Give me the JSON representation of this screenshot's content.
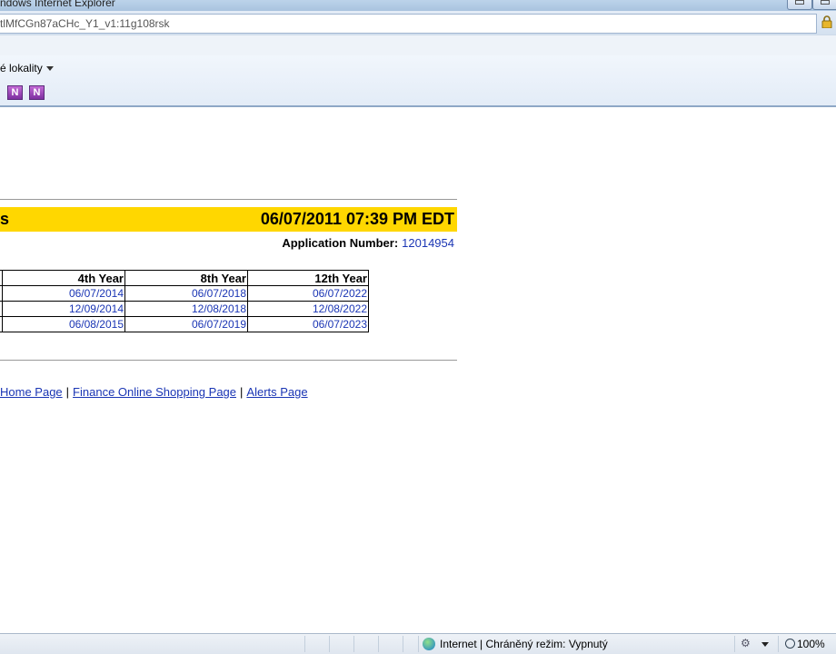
{
  "window": {
    "title": "ndows Internet Explorer"
  },
  "address": {
    "url": "tlMfCGn87aCHc_Y1_v1:11g108rsk"
  },
  "favorites": {
    "label": "é lokality"
  },
  "page": {
    "header_left": "s",
    "timestamp": "06/07/2011 07:39 PM EDT",
    "application_label": "Application Number:",
    "application_number": "12014954",
    "table": {
      "headers": [
        "4th Year",
        "8th Year",
        "12th Year"
      ],
      "rows": [
        [
          "06/07/2014",
          "06/07/2018",
          "06/07/2022"
        ],
        [
          "12/09/2014",
          "12/08/2018",
          "12/08/2022"
        ],
        [
          "06/08/2015",
          "06/07/2019",
          "06/07/2023"
        ]
      ]
    },
    "links": [
      "Home Page",
      "Finance Online Shopping Page",
      "Alerts Page"
    ],
    "separator": "|"
  },
  "status": {
    "zone": "Internet | Chráněný režim: Vypnutý",
    "zoom": "100%"
  },
  "icons": {
    "onenote": "onenote-icon",
    "onenote_linked": "onenote-linked-icon",
    "lock": "lock-icon",
    "globe": "globe-icon",
    "zoom": "zoom-icon"
  }
}
